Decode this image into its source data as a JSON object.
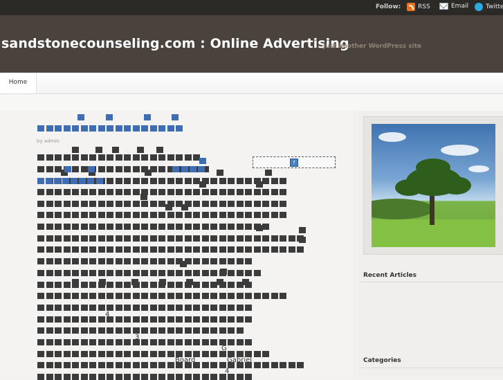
{
  "topbar": {
    "follow_label": "Follow:",
    "links": [
      {
        "label": "RSS",
        "icon": "rss-icon"
      },
      {
        "label": "Email",
        "icon": "email-icon"
      },
      {
        "label": "Twitter",
        "icon": "twitter-icon"
      }
    ]
  },
  "header": {
    "title": "sandstonecounseling.com : Online Advertising",
    "tagline": "Just another WordPress site"
  },
  "nav": {
    "items": [
      "Home"
    ]
  },
  "post": {
    "byline": "by admin",
    "fragments": [
      "4",
      "3",
      "G",
      "Board",
      "Gabriel",
      "4"
    ]
  },
  "sidebar": {
    "recent_heading": "Recent Articles",
    "categories_heading": "Categories"
  },
  "colors": {
    "topbar_bg": "#2c2a27",
    "header_bg": "#4a423c",
    "link_blue": "#3e6db4",
    "body_bg": "#f2f1ef"
  }
}
